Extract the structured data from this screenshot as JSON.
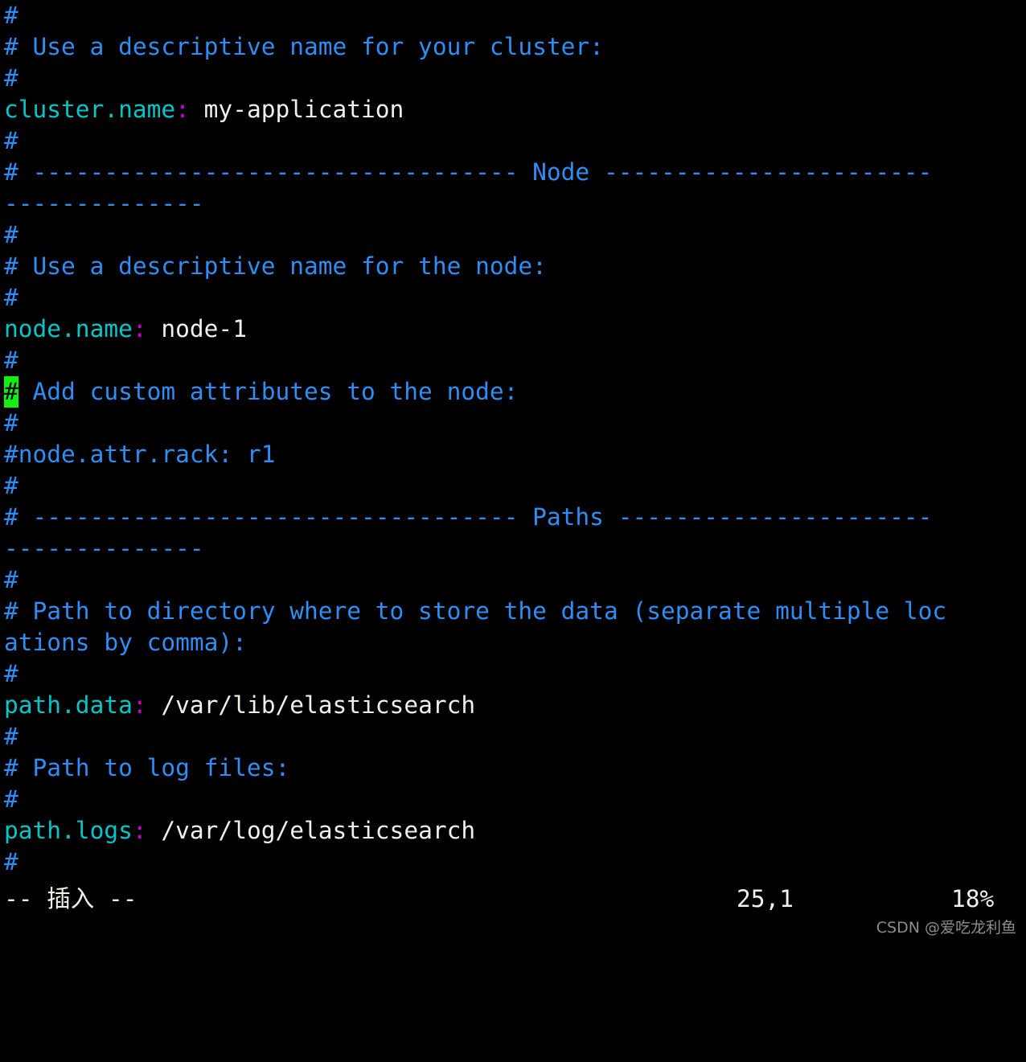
{
  "terminal": {
    "background": "#000000",
    "columns": 66,
    "rows": 28,
    "cursor_color": "#12f012",
    "colors": {
      "comment": "#2f8ef5",
      "key": "#00c7c7",
      "colon": "#c800c8",
      "value": "#f2efe8",
      "status_text": "#f2efe8",
      "watermark": "#8c8c8c"
    }
  },
  "editor": {
    "mode_label": "-- 插入 --",
    "cursor_position": "25,1",
    "scroll_percent": "18%"
  },
  "watermark": {
    "text": "CSDN @爱吃龙利鱼"
  },
  "buffer": {
    "lines": [
      {
        "id": "l01",
        "segments": [
          {
            "cls": "cmt",
            "text": "#"
          }
        ]
      },
      {
        "id": "l02",
        "segments": [
          {
            "cls": "cmt",
            "text": "# Use a descriptive name for your cluster:"
          }
        ]
      },
      {
        "id": "l03",
        "segments": [
          {
            "cls": "cmt",
            "text": "#"
          }
        ]
      },
      {
        "id": "l04",
        "segments": [
          {
            "cls": "key",
            "text": "cluster.name"
          },
          {
            "cls": "colon",
            "text": ":"
          },
          {
            "cls": "val",
            "text": " my-application"
          }
        ]
      },
      {
        "id": "l05",
        "segments": [
          {
            "cls": "cmt",
            "text": "#"
          }
        ]
      },
      {
        "id": "l06",
        "segments": [
          {
            "cls": "cmt",
            "text": "# ---------------------------------- Node -----------------------"
          }
        ]
      },
      {
        "id": "l07",
        "segments": [
          {
            "cls": "cmt",
            "text": "--------------"
          }
        ]
      },
      {
        "id": "l08",
        "segments": [
          {
            "cls": "cmt",
            "text": "#"
          }
        ]
      },
      {
        "id": "l09",
        "segments": [
          {
            "cls": "cmt",
            "text": "# Use a descriptive name for the node:"
          }
        ]
      },
      {
        "id": "l10",
        "segments": [
          {
            "cls": "cmt",
            "text": "#"
          }
        ]
      },
      {
        "id": "l11",
        "segments": [
          {
            "cls": "key",
            "text": "node.name"
          },
          {
            "cls": "colon",
            "text": ":"
          },
          {
            "cls": "val",
            "text": " node-1"
          }
        ]
      },
      {
        "id": "l12",
        "segments": [
          {
            "cls": "cmt",
            "text": "#"
          }
        ]
      },
      {
        "id": "l13",
        "segments": [
          {
            "cls": "cursor",
            "text": "#"
          },
          {
            "cls": "cmt",
            "text": " Add custom attributes to the node:"
          }
        ]
      },
      {
        "id": "l14",
        "segments": [
          {
            "cls": "cmt",
            "text": "#"
          }
        ]
      },
      {
        "id": "l15",
        "segments": [
          {
            "cls": "cmt",
            "text": "#node.attr.rack: r1"
          }
        ]
      },
      {
        "id": "l16",
        "segments": [
          {
            "cls": "cmt",
            "text": "#"
          }
        ]
      },
      {
        "id": "l17",
        "segments": [
          {
            "cls": "cmt",
            "text": "# ---------------------------------- Paths ----------------------"
          }
        ]
      },
      {
        "id": "l18",
        "segments": [
          {
            "cls": "cmt",
            "text": "--------------"
          }
        ]
      },
      {
        "id": "l19",
        "segments": [
          {
            "cls": "cmt",
            "text": "#"
          }
        ]
      },
      {
        "id": "l20",
        "segments": [
          {
            "cls": "cmt",
            "text": "# Path to directory where to store the data (separate multiple loc"
          }
        ]
      },
      {
        "id": "l21",
        "segments": [
          {
            "cls": "cmt",
            "text": "ations by comma):"
          }
        ]
      },
      {
        "id": "l22",
        "segments": [
          {
            "cls": "cmt",
            "text": "#"
          }
        ]
      },
      {
        "id": "l23",
        "segments": [
          {
            "cls": "key",
            "text": "path.data"
          },
          {
            "cls": "colon",
            "text": ":"
          },
          {
            "cls": "val",
            "text": " /var/lib/elasticsearch"
          }
        ]
      },
      {
        "id": "l24",
        "segments": [
          {
            "cls": "cmt",
            "text": "#"
          }
        ]
      },
      {
        "id": "l25",
        "segments": [
          {
            "cls": "cmt",
            "text": "# Path to log files:"
          }
        ]
      },
      {
        "id": "l26",
        "segments": [
          {
            "cls": "cmt",
            "text": "#"
          }
        ]
      },
      {
        "id": "l27",
        "segments": [
          {
            "cls": "key",
            "text": "path.logs"
          },
          {
            "cls": "colon",
            "text": ":"
          },
          {
            "cls": "val",
            "text": " /var/log/elasticsearch"
          }
        ]
      },
      {
        "id": "l28",
        "segments": [
          {
            "cls": "cmt",
            "text": "#"
          }
        ]
      }
    ]
  }
}
